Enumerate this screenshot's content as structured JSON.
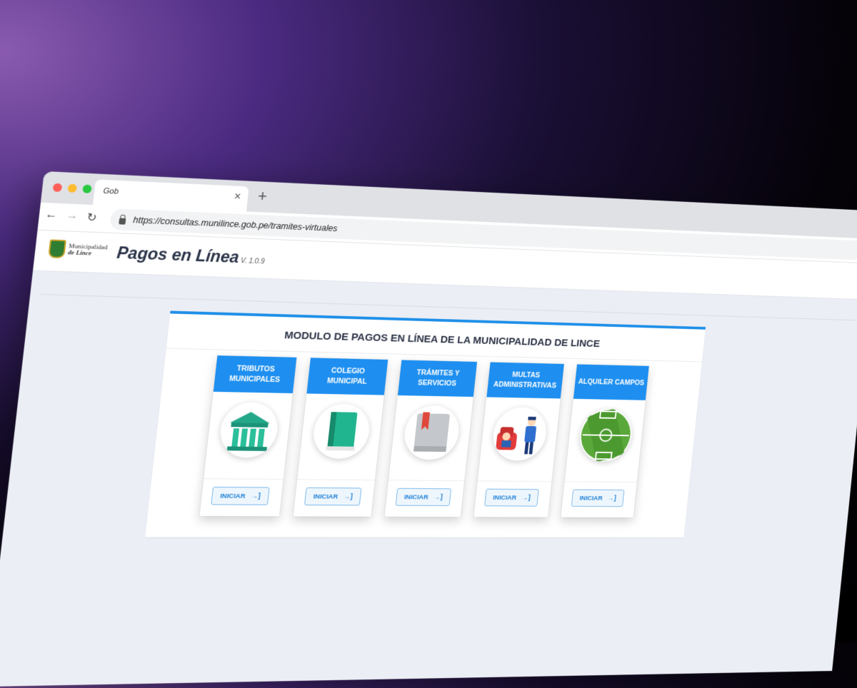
{
  "browser": {
    "tab_title": "Gob",
    "tab_close": "×",
    "new_tab": "+",
    "nav": {
      "back": "←",
      "forward": "→",
      "reload": "↻"
    },
    "url": "https://consultas.munilince.gob.pe/tramites-virtuales"
  },
  "header": {
    "logo_line1": "Municipalidad",
    "logo_line2": "de Lince",
    "title": "Pagos en Línea",
    "version": "V. 1.0.9"
  },
  "panel": {
    "title": "MODULO DE PAGOS EN LÍNEA DE LA MUNICIPALIDAD DE LINCE",
    "cards": [
      {
        "title": "TRIBUTOS MUNICIPALES",
        "icon": "bank-building-icon",
        "button": "INICIAR",
        "button_icon": "→]"
      },
      {
        "title": "COLEGIO MUNICIPAL",
        "icon": "book-icon",
        "button": "INICIAR",
        "button_icon": "→]"
      },
      {
        "title": "TRÁMITES Y SERVICIOS",
        "icon": "bookmark-icon",
        "button": "INICIAR",
        "button_icon": "→]"
      },
      {
        "title": "MULTAS ADMINISTRATIVAS",
        "icon": "traffic-police-icon",
        "button": "INICIAR",
        "button_icon": "→]"
      },
      {
        "title": "ALQUILER CAMPOS",
        "icon": "soccer-field-icon",
        "button": "INICIAR",
        "button_icon": "→]"
      }
    ]
  },
  "colors": {
    "accent": "#1e8ff0",
    "title": "#2a3348",
    "page_bg": "#ebeef5"
  }
}
